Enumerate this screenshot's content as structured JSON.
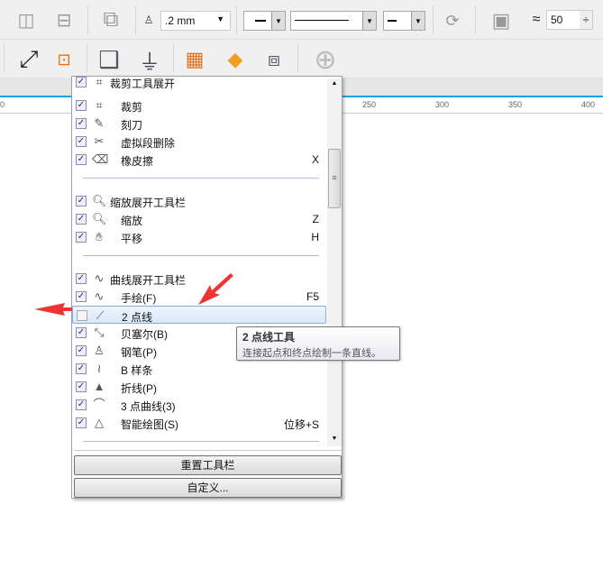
{
  "toolbar": {
    "outline_width": ".2 mm",
    "miter_value": "50"
  },
  "ruler": {
    "labels": [
      "0",
      "250",
      "300",
      "350",
      "400"
    ]
  },
  "menu": {
    "items": [
      {
        "label": "裁剪工具展开",
        "indent": false,
        "checked": true,
        "icon": "crop-icon",
        "glyph": "⌗",
        "key": ""
      },
      {
        "label": "裁剪",
        "indent": true,
        "checked": true,
        "icon": "crop-icon",
        "glyph": "⌗",
        "key": ""
      },
      {
        "label": "刻刀",
        "indent": true,
        "checked": true,
        "icon": "knife-icon",
        "glyph": "✎",
        "key": ""
      },
      {
        "label": "虚拟段删除",
        "indent": true,
        "checked": true,
        "icon": "virtual-segment-delete-icon",
        "glyph": "✂",
        "key": ""
      },
      {
        "label": "橡皮擦",
        "indent": true,
        "checked": true,
        "icon": "eraser-icon",
        "glyph": "⌫",
        "key": "X"
      },
      {
        "sep": true
      },
      {
        "label": "缩放展开工具栏",
        "indent": false,
        "checked": true,
        "icon": "zoom-icon",
        "glyph": "🔍︎",
        "key": ""
      },
      {
        "label": "缩放",
        "indent": true,
        "checked": true,
        "icon": "zoom-icon",
        "glyph": "🔍︎",
        "key": "Z"
      },
      {
        "label": "平移",
        "indent": true,
        "checked": true,
        "icon": "hand-pan-icon",
        "glyph": "✋︎",
        "key": "H"
      },
      {
        "sep": true
      },
      {
        "label": "曲线展开工具栏",
        "indent": false,
        "checked": true,
        "icon": "freehand-icon",
        "glyph": "∿",
        "key": ""
      },
      {
        "label": "手绘(F)",
        "indent": true,
        "checked": true,
        "icon": "freehand-icon",
        "glyph": "∿",
        "key": "F5"
      },
      {
        "label": "2 点线",
        "indent": true,
        "checked": false,
        "icon": "two-point-line-icon",
        "glyph": "⟋",
        "key": "",
        "highlight": true
      },
      {
        "label": "贝塞尔(B)",
        "indent": true,
        "checked": true,
        "icon": "bezier-icon",
        "glyph": "⤡",
        "key": ""
      },
      {
        "label": "钢笔(P)",
        "indent": true,
        "checked": true,
        "icon": "pen-icon",
        "glyph": "♙",
        "key": ""
      },
      {
        "label": "B 样条",
        "indent": true,
        "checked": true,
        "icon": "b-spline-icon",
        "glyph": "≀",
        "key": ""
      },
      {
        "label": "折线(P)",
        "indent": true,
        "checked": true,
        "icon": "polyline-icon",
        "glyph": "▲",
        "key": ""
      },
      {
        "label": "3 点曲线(3)",
        "indent": true,
        "checked": true,
        "icon": "three-point-curve-icon",
        "glyph": "⌒",
        "key": ""
      },
      {
        "label": "智能绘图(S)",
        "indent": true,
        "checked": true,
        "icon": "smart-drawing-icon",
        "glyph": "△",
        "key": "位移+S"
      },
      {
        "sep": true
      }
    ],
    "reset_label": "重置工具栏",
    "customize_label": "自定义..."
  },
  "tooltip": {
    "title": "2 点线工具",
    "body": "连接起点和终点绘制一条直线。"
  },
  "colors": {
    "accent": "#1aa3e8",
    "arrow": "#ee3333"
  }
}
